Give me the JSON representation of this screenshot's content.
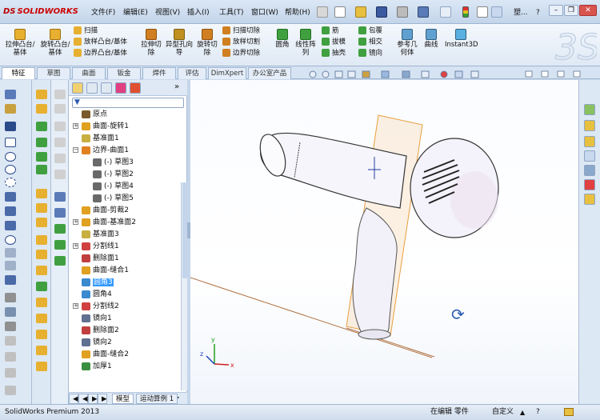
{
  "app": {
    "logo_prefix": "DS",
    "logo_text": "SOLIDWORKS"
  },
  "menu": [
    "文件(F)",
    "编辑(E)",
    "视图(V)",
    "插入(I)",
    "工具(T)",
    "窗口(W)",
    "帮助(H)"
  ],
  "search_fragment": "塑...",
  "ribbon": {
    "big_buttons": [
      {
        "label": "拉伸凸台/基体"
      },
      {
        "label": "旋转凸台/基体"
      },
      {
        "label": "拉伸切除"
      },
      {
        "label": "异型孔向导"
      },
      {
        "label": "旋转切除"
      },
      {
        "label": "圆角"
      },
      {
        "label": "线性阵列"
      },
      {
        "label": "参考几何体"
      },
      {
        "label": "曲线"
      },
      {
        "label": "Instant3D"
      }
    ],
    "small_col1": [
      "扫描",
      "放样凸台/基体",
      "边界凸台/基体"
    ],
    "small_col2": [
      "扫描切除",
      "放样切割",
      "边界切除"
    ],
    "small_col3": [
      "筋",
      "拔模",
      "抽壳"
    ],
    "small_col4": [
      "包覆",
      "相交",
      "镜向"
    ]
  },
  "tabs": [
    "特征",
    "草图",
    "曲面",
    "钣金",
    "焊件",
    "评估",
    "DimXpert",
    "办公室产品"
  ],
  "tree": {
    "nodes": [
      {
        "label": "原点",
        "indent": 0,
        "icon_color": "#7a5a2a",
        "expander": ""
      },
      {
        "label": "曲面-旋转1",
        "indent": 0,
        "icon_color": "#e0a020",
        "expander": "+"
      },
      {
        "label": "基准面1",
        "indent": 0,
        "icon_color": "#c8b040",
        "expander": ""
      },
      {
        "label": "边界-曲面1",
        "indent": 0,
        "icon_color": "#e08020",
        "expander": "−"
      },
      {
        "label": "(-) 草图3",
        "indent": 1,
        "icon_color": "#6a6a6a",
        "expander": ""
      },
      {
        "label": "(-) 草图2",
        "indent": 1,
        "icon_color": "#6a6a6a",
        "expander": ""
      },
      {
        "label": "(-) 草图4",
        "indent": 1,
        "icon_color": "#6a6a6a",
        "expander": ""
      },
      {
        "label": "(-) 草图5",
        "indent": 1,
        "icon_color": "#6a6a6a",
        "expander": ""
      },
      {
        "label": "曲面-剪裁2",
        "indent": 0,
        "icon_color": "#e0a020",
        "expander": ""
      },
      {
        "label": "曲面-基准面2",
        "indent": 0,
        "icon_color": "#e0a020",
        "expander": "+"
      },
      {
        "label": "基准面3",
        "indent": 0,
        "icon_color": "#c8b040",
        "expander": ""
      },
      {
        "label": "分割线1",
        "indent": 0,
        "icon_color": "#d04040",
        "expander": "+"
      },
      {
        "label": "删除面1",
        "indent": 0,
        "icon_color": "#c04040",
        "expander": ""
      },
      {
        "label": "曲面-缝合1",
        "indent": 0,
        "icon_color": "#e0a020",
        "expander": ""
      },
      {
        "label": "圆角3",
        "indent": 0,
        "icon_color": "#3a8ad0",
        "expander": "",
        "selected": true
      },
      {
        "label": "圆角4",
        "indent": 0,
        "icon_color": "#3a8ad0",
        "expander": ""
      },
      {
        "label": "分割线2",
        "indent": 0,
        "icon_color": "#d04040",
        "expander": "+"
      },
      {
        "label": "镜向1",
        "indent": 0,
        "icon_color": "#607090",
        "expander": ""
      },
      {
        "label": "删除面2",
        "indent": 0,
        "icon_color": "#c04040",
        "expander": ""
      },
      {
        "label": "镜向2",
        "indent": 0,
        "icon_color": "#607090",
        "expander": ""
      },
      {
        "label": "曲面-缝合2",
        "indent": 0,
        "icon_color": "#e0a020",
        "expander": ""
      },
      {
        "label": "加厚1",
        "indent": 0,
        "icon_color": "#3a9040",
        "expander": ""
      }
    ]
  },
  "bottom_tabs": [
    "模型",
    "运动算例 1"
  ],
  "status": {
    "left": "SolidWorks Premium 2013",
    "editing": "在编辑 零件",
    "units": "自定义"
  },
  "triad": {
    "x": "x",
    "y": "y",
    "z": "z"
  },
  "colors": {
    "accent": "#3399ff",
    "logo": "#cc0000",
    "plane": "#e8a040"
  }
}
